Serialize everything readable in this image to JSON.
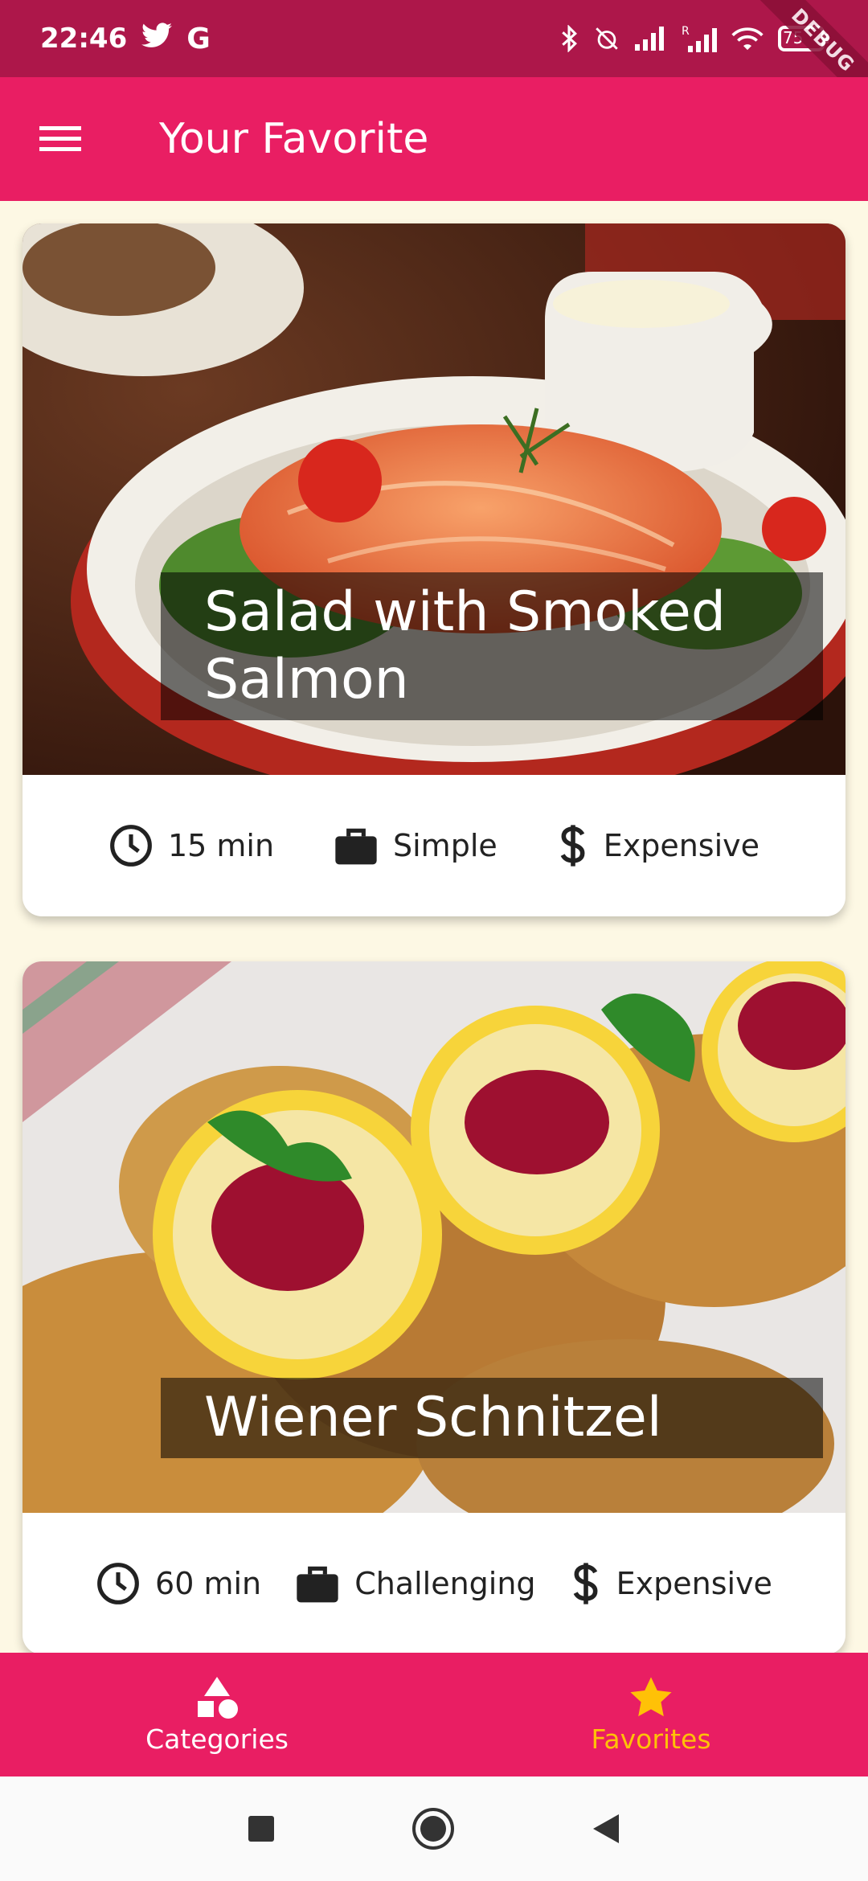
{
  "status_bar": {
    "time": "22:46",
    "icons": [
      "twitter-icon",
      "google-icon",
      "bluetooth-icon",
      "alarm-off-icon",
      "signal-icon",
      "signal-roaming-icon",
      "wifi-icon",
      "battery-icon"
    ],
    "battery": "75",
    "debug_banner": "DEBUG"
  },
  "app_bar": {
    "title": "Your Favorite",
    "menu_icon": "hamburger-menu-icon",
    "background": "#e91e63"
  },
  "meals": [
    {
      "title": "Salad with Smoked Salmon",
      "duration": "15 min",
      "complexity": "Simple",
      "affordability": "Expensive"
    },
    {
      "title": "Wiener Schnitzel",
      "duration": "60 min",
      "complexity": "Challenging",
      "affordability": "Expensive"
    }
  ],
  "bottom_nav": {
    "items": [
      {
        "label": "Categories",
        "icon": "category-shapes-icon",
        "active": false
      },
      {
        "label": "Favorites",
        "icon": "star-icon",
        "active": true
      }
    ],
    "active_color": "#ffc107"
  },
  "system_nav": [
    "recents-square-icon",
    "home-circle-icon",
    "back-triangle-icon"
  ]
}
